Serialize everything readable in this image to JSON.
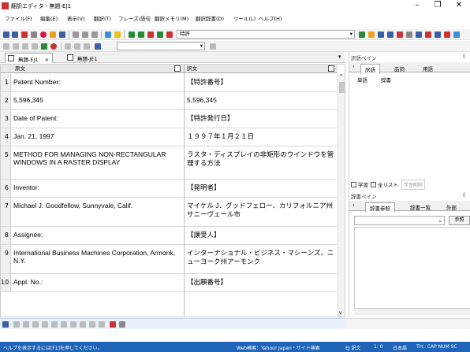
{
  "window": {
    "title": "翻訳エディタ - 無題-EJ1"
  },
  "menu": [
    "ファイル(F)",
    "編集(E)",
    "表示(V)",
    "翻訳(T)",
    "フレーズ/語句",
    "翻訳メモリ(M)",
    "翻訳辞書(D)",
    "ツール(L)",
    "ヘルプ(H)"
  ],
  "toolbar": {
    "field_value": "特許"
  },
  "tabs": [
    {
      "label": "無題-EJ1",
      "close": "×"
    },
    {
      "label": "無題-JE1"
    }
  ],
  "grid": {
    "source_header": "原文",
    "target_header": "訳文",
    "rows": [
      {
        "num": "1",
        "source": "Patent Number:",
        "target": "【特許番号】"
      },
      {
        "num": "2",
        "source": "5,596,345",
        "target": "5,596,345"
      },
      {
        "num": "3",
        "source": "Date of Patent:",
        "target": "【特許発行日】"
      },
      {
        "num": "4",
        "source": "Jan. 21, 1997",
        "target": "１９９７年１月２１日"
      },
      {
        "num": "5",
        "source": "METHOD FOR MANAGING NON-RECTANGULAR WINDOWS IN A RASTER DISPLAY",
        "target": "ラスタ・ディスプレイの非矩形のウインドウを管理する方法"
      },
      {
        "num": "6",
        "source": "Inventor:",
        "target": "【発明者】"
      },
      {
        "num": "7",
        "source": "Michael J. Goodfellow, Sunnyvale, Calif.",
        "target": "マイケル J．グッドフェロー、カリフォルニア州サニーヴェール市"
      },
      {
        "num": "8",
        "source": "Assignee:",
        "target": "【譲受人】"
      },
      {
        "num": "9",
        "source": "International Business Machines Corporation, Armonk, N.Y.",
        "target": "インターナショナル・ビジネス・マシーンズ、ニューヨーク州アーモンク"
      },
      {
        "num": "10",
        "source": "Appl. No.:",
        "target": "【出願番号】"
      }
    ]
  },
  "glossary_pane": {
    "title": "訳語ペイン",
    "tabs": [
      "訳語",
      "品詞",
      "用語"
    ],
    "col_word": "単語",
    "col_dict": "辞書",
    "check_learn": "学習",
    "check_all": "全リスト",
    "learn_button": "学習削除"
  },
  "dict_pane": {
    "title": "辞書ペイン",
    "tabs": [
      "辞書参照",
      "辞書一覧",
      "外部"
    ],
    "ref_button": "参照"
  },
  "status": {
    "help": "ヘルプを表示するには[F1]を押してください。",
    "web_search": "Web検索：Yahoo! Japan・サイト検索",
    "mode": "EJ 訳文",
    "pos": "1:  0",
    "lang": "日本語",
    "keys": "TH.. CAP NUM SC"
  },
  "colors": {
    "status_bg": "#1f64b8",
    "accent_red": "#cc2222"
  }
}
